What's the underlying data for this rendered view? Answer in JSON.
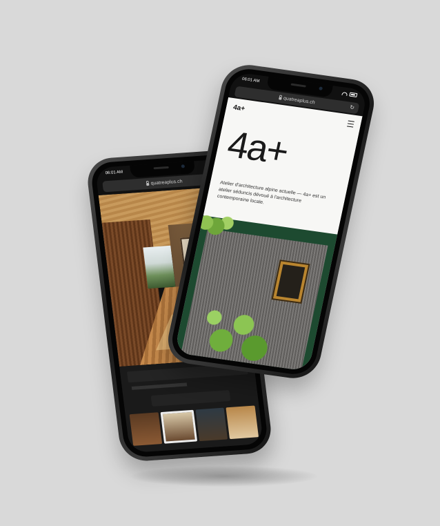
{
  "back_phone": {
    "status_time": "06:01 AM",
    "url": "quatreaplus.ch",
    "reload_glyph": "↻"
  },
  "front_phone": {
    "status_time": "06:01 AM",
    "url": "quatreaplus.ch",
    "reload_glyph": "↻",
    "logo": "4a+",
    "hero_title": "4a+",
    "tagline": "Atelier d'architecture alpine actuelle — 4a+ est un atelier séduncis dévoué à l'architecture contemporaine locale."
  },
  "icons": [
    "wifi-icon",
    "battery-icon",
    "lock-icon",
    "reload-icon",
    "menu-icon"
  ],
  "colors": {
    "background": "#d9d9d9",
    "green_band": "#1d4a30",
    "page_background": "#f7f7f5"
  }
}
